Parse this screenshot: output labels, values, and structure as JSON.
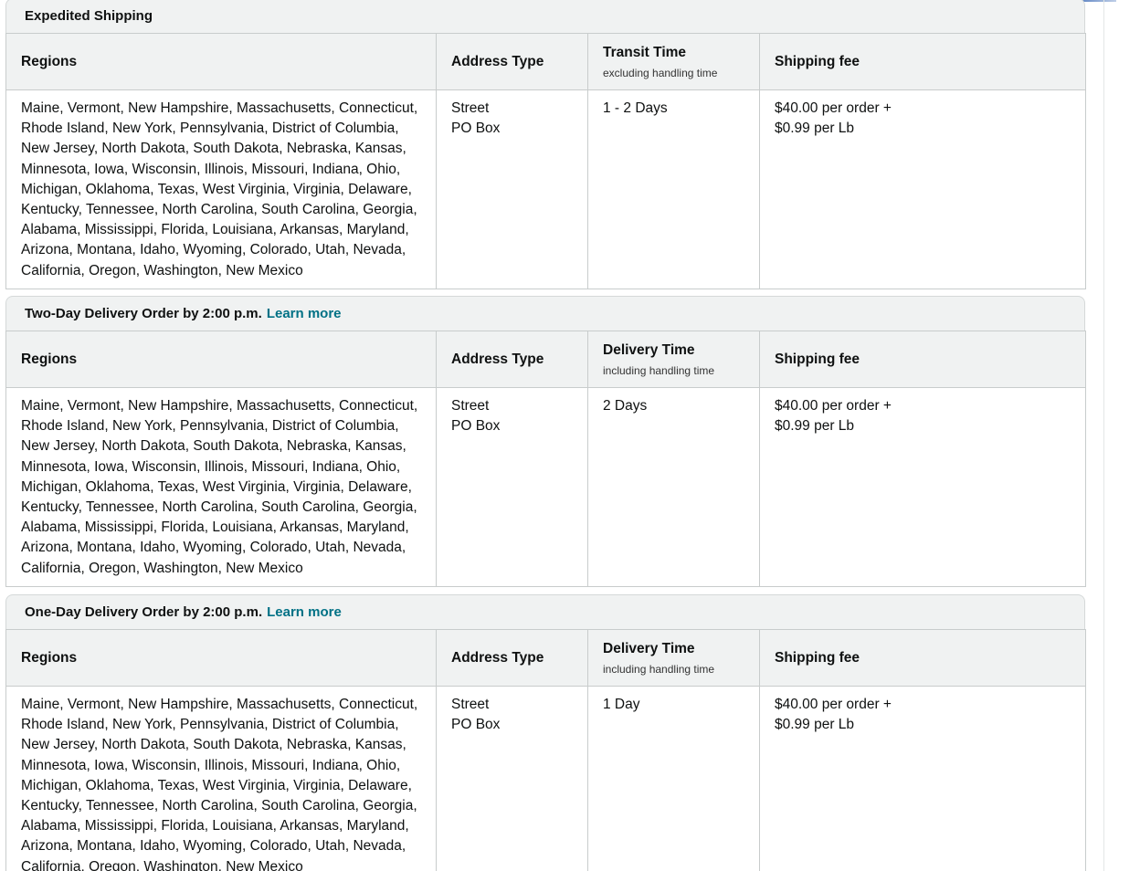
{
  "sections": [
    {
      "title": "Expedited Shipping",
      "learn_more": "",
      "headers": {
        "regions": "Regions",
        "address_type": "Address Type",
        "time": "Transit Time",
        "time_note": "excluding handling time",
        "fee": "Shipping fee"
      },
      "row": {
        "regions": "Maine, Vermont, New Hampshire, Massachusetts, Connecticut, Rhode Island, New York, Pennsylvania, District of Columbia, New Jersey, North Dakota, South Dakota, Nebraska, Kansas, Minnesota, Iowa, Wisconsin, Illinois, Missouri, Indiana, Ohio, Michigan, Oklahoma, Texas, West Virginia, Virginia, Delaware, Kentucky, Tennessee, North Carolina, South Carolina, Georgia, Alabama, Mississippi, Florida, Louisiana, Arkansas, Maryland, Arizona, Montana, Idaho, Wyoming, Colorado, Utah, Nevada, California, Oregon, Washington, New Mexico",
        "address_types": [
          "Street",
          "PO Box"
        ],
        "time": "1 - 2 Days",
        "fee_lines": [
          "$40.00 per order +",
          "$0.99 per Lb"
        ]
      }
    },
    {
      "title": "Two-Day Delivery Order by 2:00 p.m.",
      "learn_more": "Learn more",
      "headers": {
        "regions": "Regions",
        "address_type": "Address Type",
        "time": "Delivery Time",
        "time_note": "including handling time",
        "fee": "Shipping fee"
      },
      "row": {
        "regions": "Maine, Vermont, New Hampshire, Massachusetts, Connecticut, Rhode Island, New York, Pennsylvania, District of Columbia, New Jersey, North Dakota, South Dakota, Nebraska, Kansas, Minnesota, Iowa, Wisconsin, Illinois, Missouri, Indiana, Ohio, Michigan, Oklahoma, Texas, West Virginia, Virginia, Delaware, Kentucky, Tennessee, North Carolina, South Carolina, Georgia, Alabama, Mississippi, Florida, Louisiana, Arkansas, Maryland, Arizona, Montana, Idaho, Wyoming, Colorado, Utah, Nevada, California, Oregon, Washington, New Mexico",
        "address_types": [
          "Street",
          "PO Box"
        ],
        "time": "2 Days",
        "fee_lines": [
          "$40.00 per order +",
          "$0.99 per Lb"
        ]
      }
    },
    {
      "title": "One-Day Delivery Order by 2:00 p.m.",
      "learn_more": "Learn more",
      "headers": {
        "regions": "Regions",
        "address_type": "Address Type",
        "time": "Delivery Time",
        "time_note": "including handling time",
        "fee": "Shipping fee"
      },
      "row": {
        "regions": "Maine, Vermont, New Hampshire, Massachusetts, Connecticut, Rhode Island, New York, Pennsylvania, District of Columbia, New Jersey, North Dakota, South Dakota, Nebraska, Kansas, Minnesota, Iowa, Wisconsin, Illinois, Missouri, Indiana, Ohio, Michigan, Oklahoma, Texas, West Virginia, Virginia, Delaware, Kentucky, Tennessee, North Carolina, South Carolina, Georgia, Alabama, Mississippi, Florida, Louisiana, Arkansas, Maryland, Arizona, Montana, Idaho, Wyoming, Colorado, Utah, Nevada, California, Oregon, Washington, New Mexico",
        "address_types": [
          "Street",
          "PO Box"
        ],
        "time": "1 Day",
        "fee_lines": [
          "$40.00 per order +",
          "$0.99 per Lb"
        ]
      }
    }
  ],
  "colors": {
    "header_bg": "#f0f2f2",
    "border": "#c8cccc",
    "link": "#007185",
    "text": "#0f1111"
  }
}
